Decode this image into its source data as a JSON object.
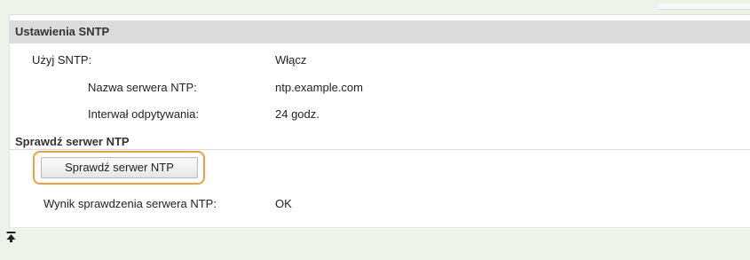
{
  "panel": {
    "header_title": "Ustawienia SNTP",
    "rows": [
      {
        "label": "Użyj SNTP:",
        "value": "Włącz"
      },
      {
        "label": "Nazwa serwera NTP:",
        "value": "ntp.example.com"
      },
      {
        "label": "Interwał odpytywania:",
        "value": "24 godz."
      }
    ],
    "check_section": {
      "title": "Sprawdź serwer NTP",
      "button_label": "Sprawdź serwer NTP",
      "result_label": "Wynik sprawdzenia serwera NTP:",
      "result_value": "OK"
    }
  },
  "icons": {
    "back_to_top": "arrow-to-top-icon"
  },
  "colors": {
    "page_background": "#eef3ea",
    "header_background": "#dcdcdc",
    "highlight_border": "#f0a03c"
  }
}
